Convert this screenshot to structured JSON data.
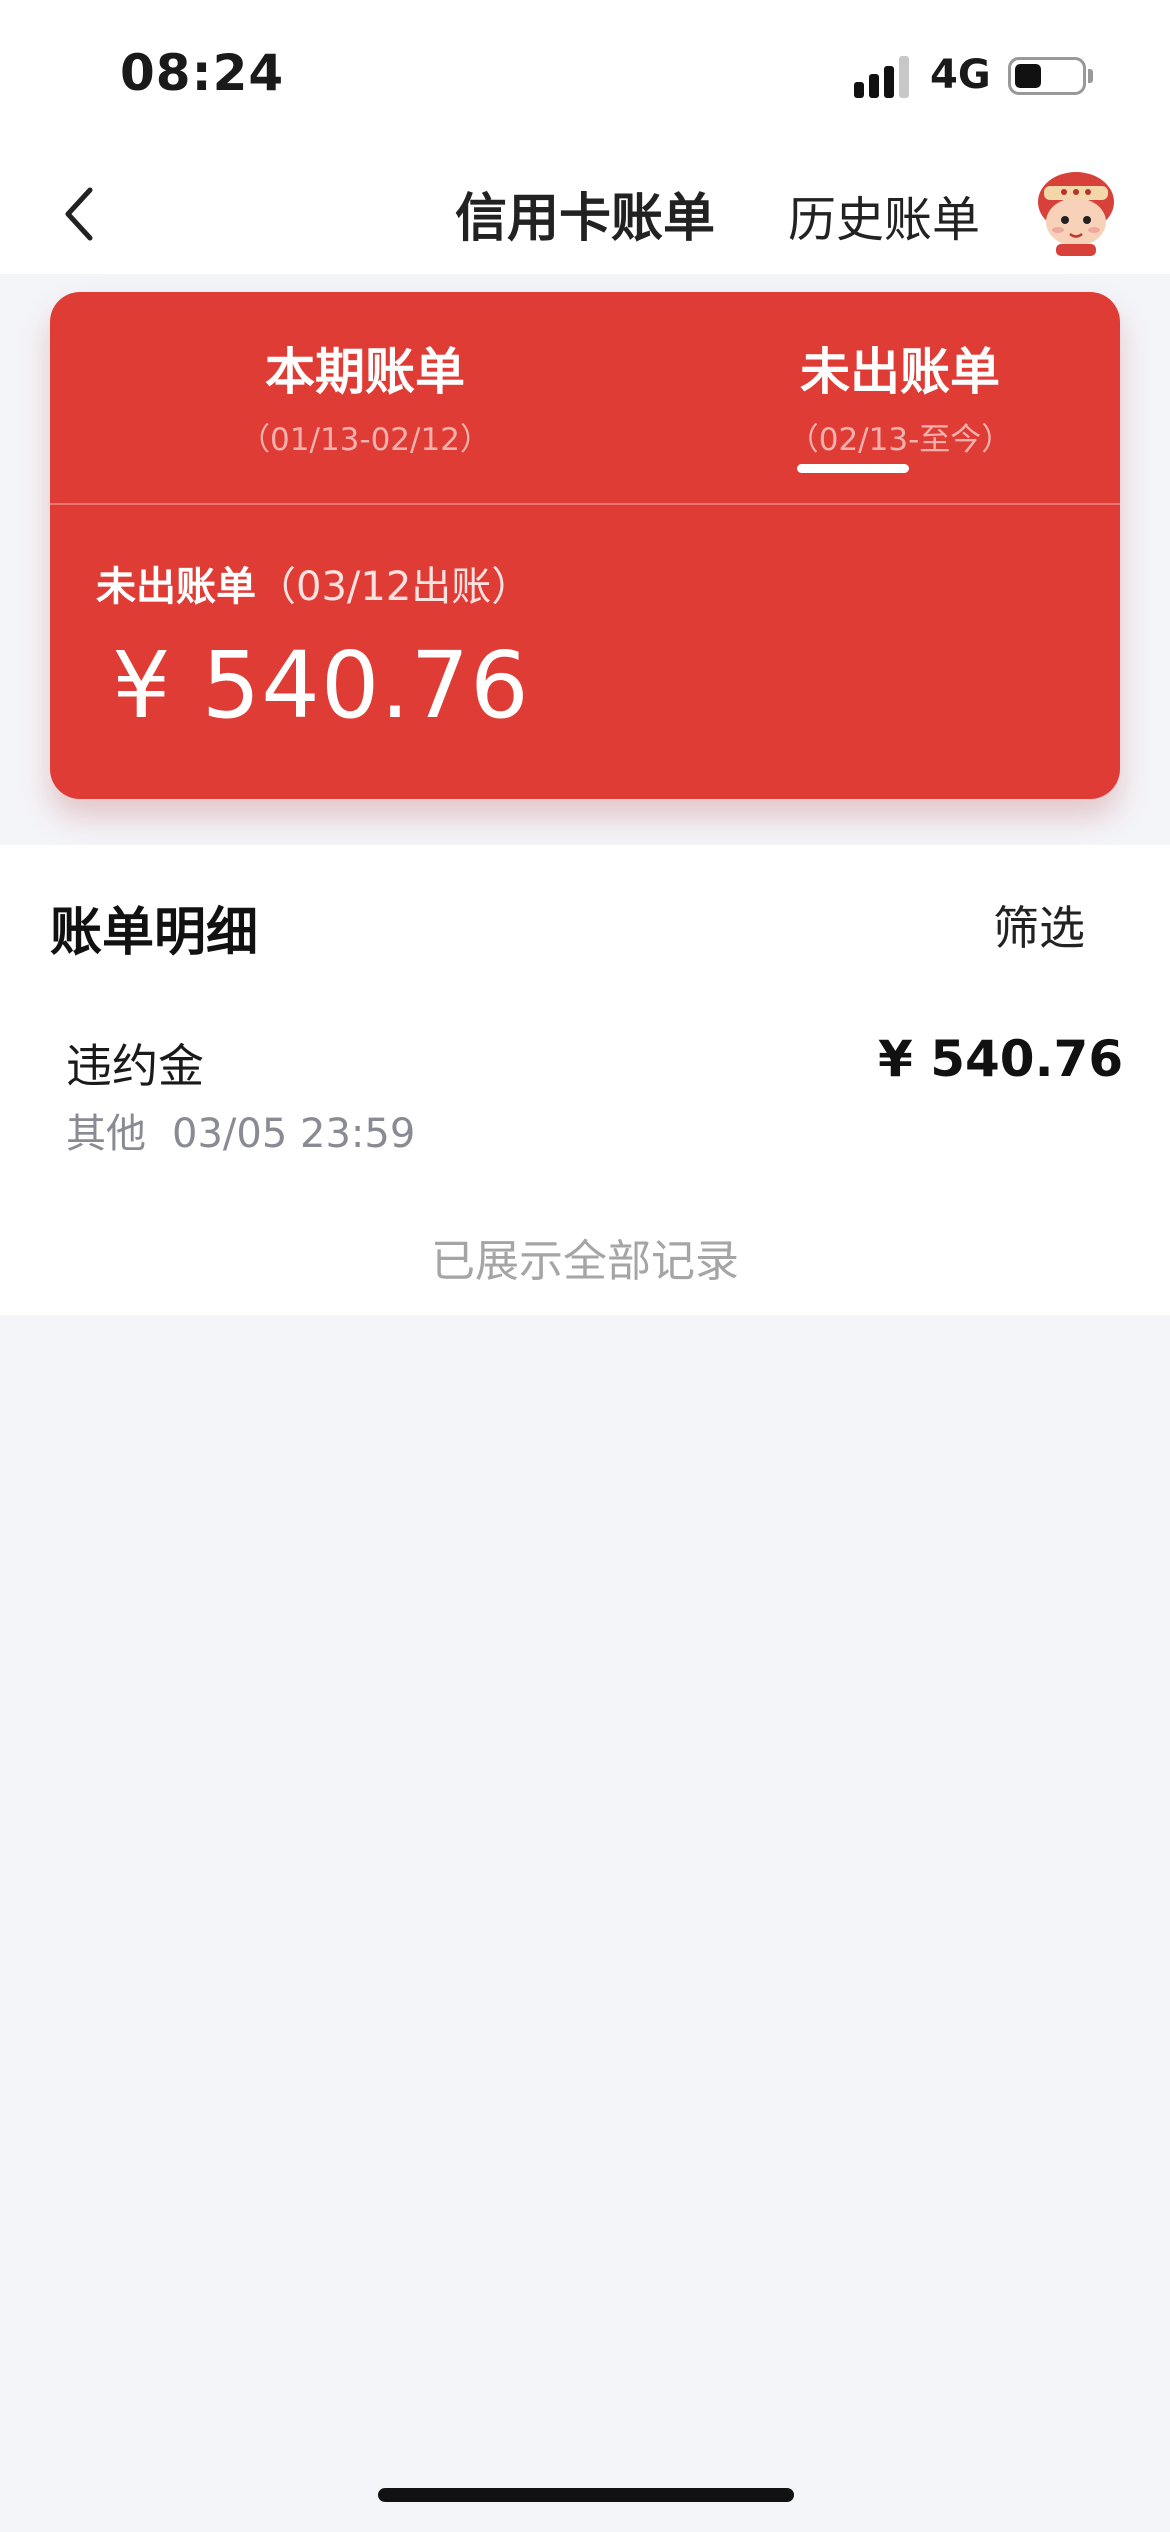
{
  "status_bar": {
    "time": "08:24",
    "network": "4G",
    "signal_icon": "signal-bars-icon",
    "battery_icon": "battery-icon"
  },
  "nav": {
    "back_icon": "chevron-left-icon",
    "title": "信用卡账单",
    "history_label": "历史账单",
    "avatar_icon": "mascot-avatar-icon"
  },
  "bill_card": {
    "color": "#e03c36",
    "tabs": [
      {
        "label": "本期账单",
        "range": "（01/13-02/12）",
        "selected": false
      },
      {
        "label": "未出账单",
        "range": "（02/13-至今）",
        "selected": true
      }
    ],
    "unbilled_label": "未出账单",
    "statement_date": "（03/12出账）",
    "amount": "¥ 540.76"
  },
  "details": {
    "title": "账单明细",
    "filter_label": "筛选",
    "records": [
      {
        "name": "违约金",
        "category": "其他",
        "datetime": "03/05 23:59",
        "amount": "¥ 540.76"
      }
    ],
    "all_shown_text": "已展示全部记录"
  }
}
